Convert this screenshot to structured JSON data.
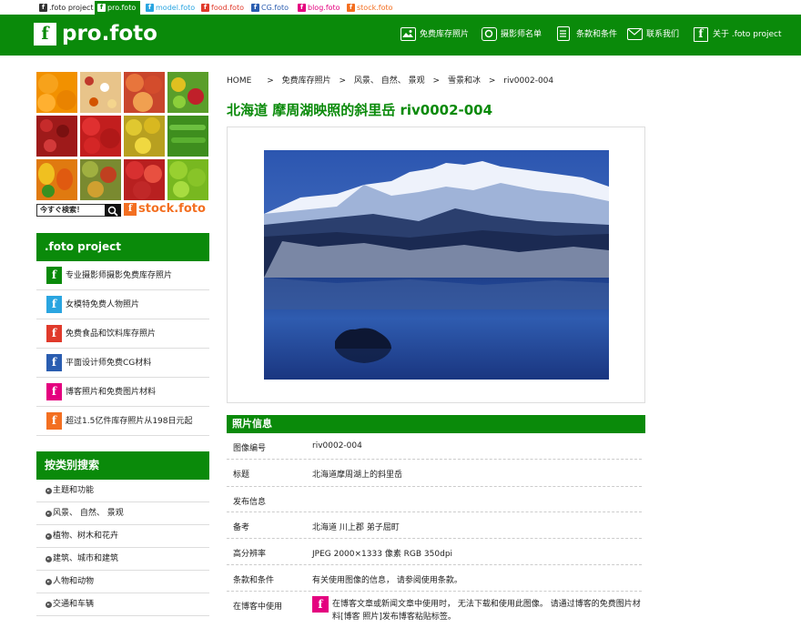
{
  "top_tabs": [
    {
      "label": ".foto project",
      "color": "#333333"
    },
    {
      "label": "pro.foto",
      "color": "#0a8a0a"
    },
    {
      "label": "model.foto",
      "color": "#2aa5e0"
    },
    {
      "label": "food.foto",
      "color": "#e03a2b"
    },
    {
      "label": "CG.foto",
      "color": "#2a5db0"
    },
    {
      "label": "blog.foto",
      "color": "#e4007f"
    },
    {
      "label": "stock.foto",
      "color": "#f36f21"
    }
  ],
  "header": {
    "logo_mark": "f",
    "logo_text": "pro.foto",
    "nav": [
      {
        "label": "免费库存照片",
        "icon": "image-icon"
      },
      {
        "label": "摄影师名单",
        "icon": "camera-icon"
      },
      {
        "label": "条款和条件",
        "icon": "document-icon"
      },
      {
        "label": "联系我们",
        "icon": "mail-icon"
      },
      {
        "label": "关于 .foto project",
        "icon": "f-logo-icon"
      }
    ]
  },
  "sidebar": {
    "search_label": "今すぐ検索！",
    "stock_logo_mark": "f",
    "stock_logo_text": "stock.foto",
    "project_heading": ".foto project",
    "project_items": [
      {
        "label": "专业摄影师摄影免费库存照片",
        "color": "#0a8a0a"
      },
      {
        "label": "女模特免费人物照片",
        "color": "#2aa5e0"
      },
      {
        "label": "免费食品和饮料库存照片",
        "color": "#e03a2b"
      },
      {
        "label": "平面设计师免费CG材料",
        "color": "#2a5db0"
      },
      {
        "label": "博客照片和免费图片材料",
        "color": "#e4007f"
      },
      {
        "label": "超过1.5亿件库存照片从198日元起",
        "color": "#f36f21"
      }
    ],
    "category_heading": "按类别搜索",
    "categories": [
      "主题和功能",
      "风景、 自然、 景观",
      "植物、树木和花卉",
      "建筑、城市和建筑",
      "人物和动物",
      "交通和车辆"
    ]
  },
  "breadcrumb": [
    "HOME",
    ">",
    "免费库存照片",
    ">",
    "风景、 自然、 景观",
    ">",
    "雪景和冰",
    ">",
    "riv0002-004"
  ],
  "page_title": "北海道 摩周湖映照的斜里岳 riv0002-004",
  "info": {
    "heading": "照片信息",
    "rows": [
      {
        "key": "图像编号",
        "value": "riv0002-004"
      },
      {
        "key": "标题",
        "value": "北海道摩周湖上的斜里岳"
      },
      {
        "key": "发布信息",
        "value": ""
      },
      {
        "key": "备考",
        "value": "北海道 川上郡 弟子屈町"
      },
      {
        "key": "高分辨率",
        "value": "JPEG 2000×1333 像素 RGB 350dpi"
      },
      {
        "key": "条款和条件",
        "value": "有关使用图像的信息， 请参阅使用条款。"
      },
      {
        "key": "在博客中使用",
        "value": "在博客文章或新闻文章中使用时， 无法下载和使用此图像。 请通过博客的免费图片材料[博客 照片]发布博客粘贴标签。",
        "icon_mark": "f"
      }
    ]
  }
}
